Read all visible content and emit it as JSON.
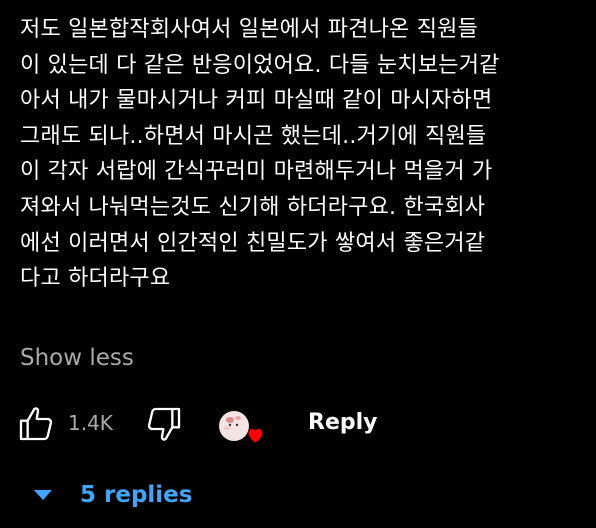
{
  "comment": {
    "text": "저도 일본합작회사여서 일본에서 파견나온 직원들\n이 있는데 다 같은 반응이었어요. 다들 눈치보는거같\n아서 내가 물마시거나 커피 마실때 같이 마시자하면\n그래도 되나..하면서 마시곤 했는데..거기에 직원들\n이 각자 서랍에 간식꾸러미 마련해두거나 먹을거 가\n져와서 나눠먹는것도 신기해 하더라구요. 한국회사\n에선 이러면서 인간적인 친밀도가 쌓여서 좋은거같\n다고 하더라구요",
    "show_less_label": "Show less"
  },
  "actions": {
    "like_icon": "thumbs-up-icon",
    "like_count": "1.4K",
    "dislike_icon": "thumbs-down-icon",
    "creator_heart_icon": "creator-heart-icon",
    "reply_label": "Reply"
  },
  "replies": {
    "toggle_icon": "caret-down-icon",
    "label": "5 replies"
  },
  "colors": {
    "background": "#000000",
    "text": "#ffffff",
    "muted": "#aaaaaa",
    "link_blue": "#3ea6ff",
    "heart_red": "#ff0000"
  }
}
